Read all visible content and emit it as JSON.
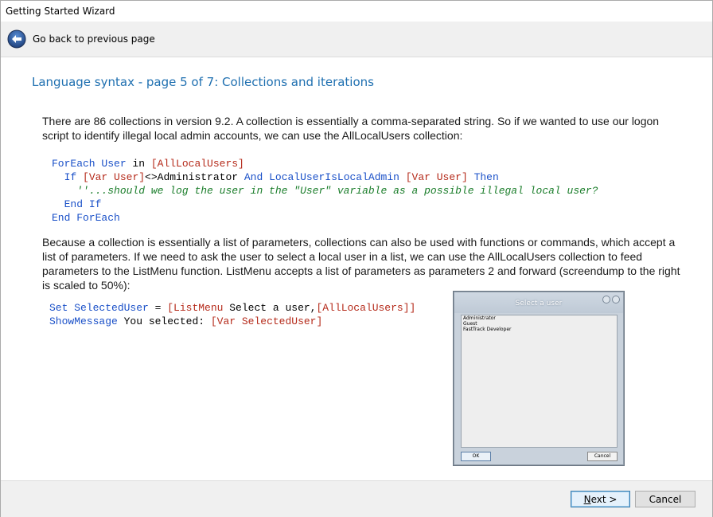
{
  "window": {
    "title": "Getting Started Wizard"
  },
  "nav": {
    "back_label": "Go back to previous page"
  },
  "page": {
    "heading": "Language syntax - page 5 of 7: Collections and iterations",
    "paragraph1": "There are 86 collections in version 9.2. A collection is essentially a comma-separated string. So if we wanted to use our logon script to identify illegal local admin accounts, we can use the AllLocalUsers collection:",
    "paragraph2": "Because a collection is essentially a list of parameters, collections can also be used with functions or commands, which accept a list of parameters. If we need to ask the user to select a local user in a list, we can use the AllLocalUsers collection to feed parameters to the ListMenu function. ListMenu accepts a list of parameters as parameters 2 and forward (screendump to the right is scaled to 50%):"
  },
  "code1": {
    "l1_kw": "ForEach User",
    "l1_in": " in ",
    "l1_br": "[AllLocalUsers]",
    "l2_indent": "  ",
    "l2_kw1": "If",
    "l2_sp": " ",
    "l2_br1": "[Var User]",
    "l2_txt": "<>Administrator ",
    "l2_kw2": "And",
    "l2_sp2": " ",
    "l2_kw3": "LocalUserIsLocalAdmin",
    "l2_sp3": " ",
    "l2_br2": "[Var User]",
    "l2_sp4": " ",
    "l2_kw4": "Then",
    "l3_indent": "    ",
    "l3_cm": "''...should we log the user in the \"User\" variable as a possible illegal local user?",
    "l4_indent": "  ",
    "l4_kw": "End If",
    "l5_kw": "End ForEach"
  },
  "code2": {
    "l1_kw": "Set SelectedUser",
    "l1_eq": " = ",
    "l1_br1": "[ListMenu",
    "l1_txt": " Select a user,",
    "l1_br2": "[AllLocalUsers]]",
    "l2_kw": "ShowMessage",
    "l2_txt": " You selected: ",
    "l2_br": "[Var SelectedUser]"
  },
  "dialog": {
    "title": "Select a user",
    "items": [
      "Administrator",
      "Guest",
      "FastTrack Developer"
    ],
    "ok_label": "OK",
    "cancel_label": "Cancel"
  },
  "footer": {
    "next_label_u": "N",
    "next_label_rest": "ext >",
    "cancel_label": "Cancel"
  }
}
